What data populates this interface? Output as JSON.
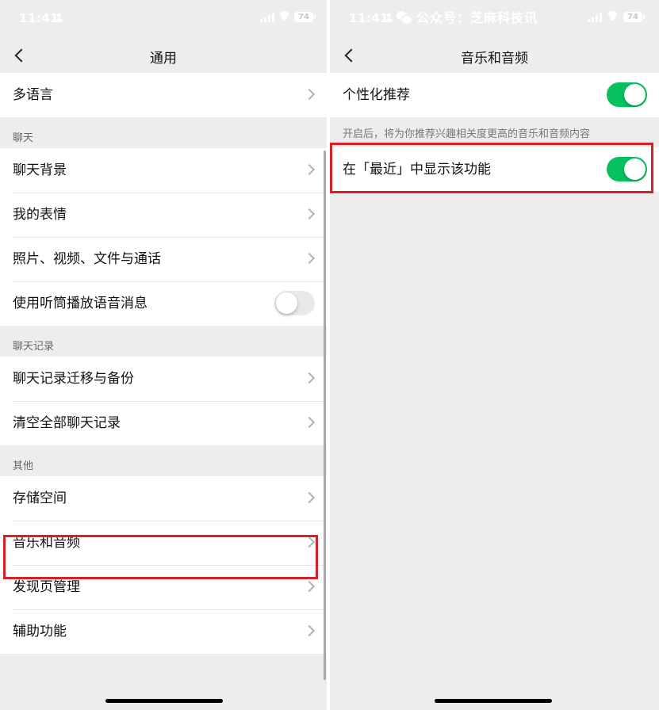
{
  "left": {
    "status": {
      "time": "11:41",
      "battery": "74"
    },
    "nav": {
      "title": "通用"
    },
    "cells_top": [
      {
        "label": "多语言",
        "control": "chevron"
      }
    ],
    "sections": [
      {
        "title": "聊天",
        "items": [
          {
            "label": "聊天背景",
            "control": "chevron"
          },
          {
            "label": "我的表情",
            "control": "chevron"
          },
          {
            "label": "照片、视频、文件与通话",
            "control": "chevron"
          },
          {
            "label": "使用听筒播放语音消息",
            "control": "toggle-off"
          }
        ]
      },
      {
        "title": "聊天记录",
        "items": [
          {
            "label": "聊天记录迁移与备份",
            "control": "chevron"
          },
          {
            "label": "清空全部聊天记录",
            "control": "chevron"
          }
        ]
      },
      {
        "title": "其他",
        "items": [
          {
            "label": "存储空间",
            "control": "chevron"
          },
          {
            "label": "音乐和音频",
            "control": "chevron",
            "highlighted": true
          },
          {
            "label": "发现页管理",
            "control": "chevron"
          },
          {
            "label": "辅助功能",
            "control": "chevron"
          }
        ]
      }
    ]
  },
  "right": {
    "status": {
      "time": "11:41",
      "battery": "74"
    },
    "watermark": "公众号：芝麻科技讯",
    "nav": {
      "title": "音乐和音频"
    },
    "personalized": {
      "label": "个性化推荐",
      "enabled": true
    },
    "hint": "开启后，将为你推荐兴趣相关度更高的音乐和音频内容",
    "recent": {
      "label": "在「最近」中显示该功能",
      "enabled": true,
      "highlighted": true
    }
  },
  "colors": {
    "accent_green": "#07c160",
    "highlight_red": "#d6212b",
    "background": "#ededed"
  }
}
